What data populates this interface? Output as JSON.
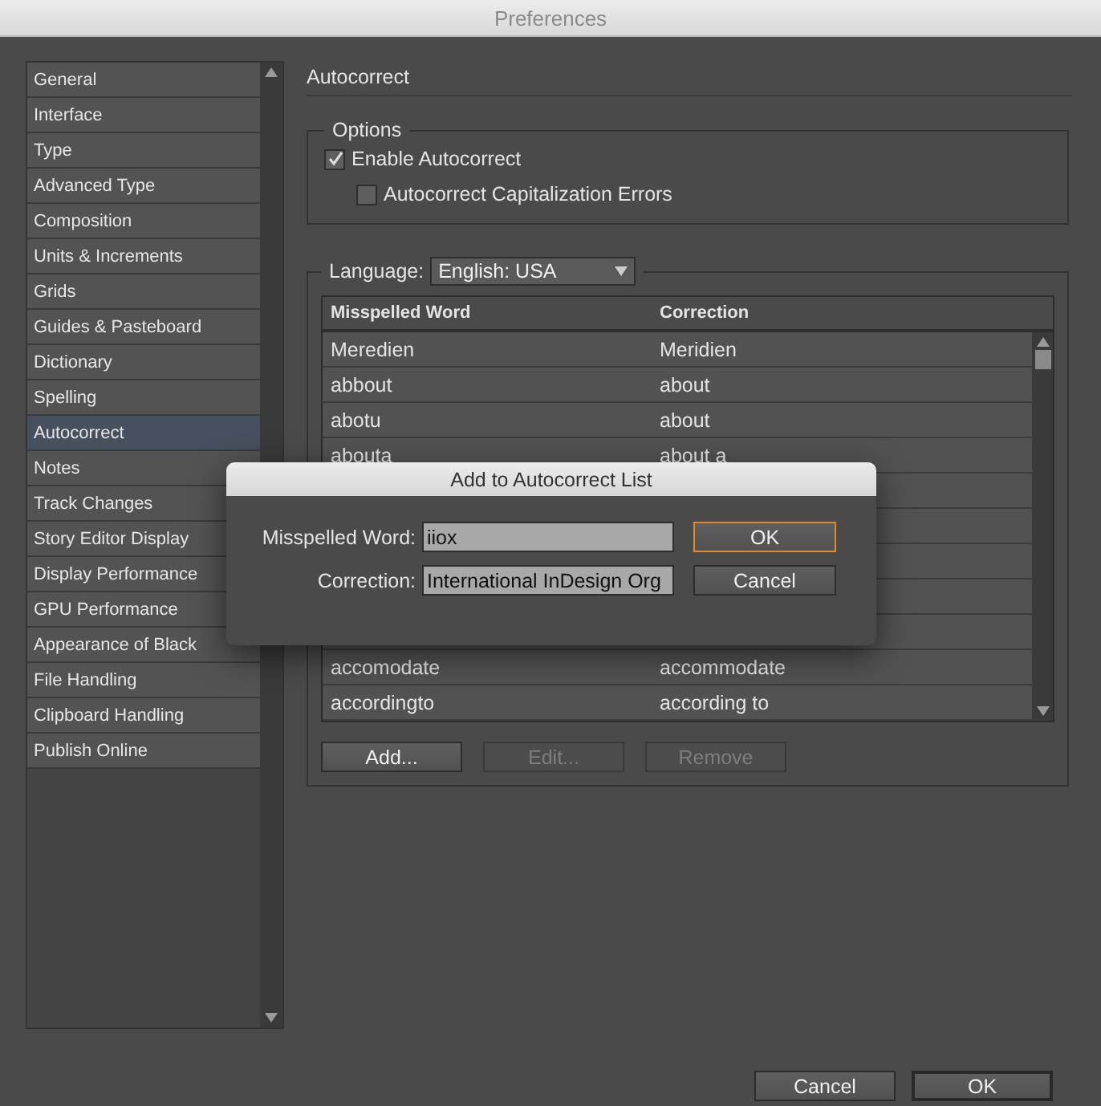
{
  "window": {
    "title": "Preferences"
  },
  "sidebar": {
    "items": [
      {
        "label": "General",
        "selected": false
      },
      {
        "label": "Interface",
        "selected": false
      },
      {
        "label": "Type",
        "selected": false
      },
      {
        "label": "Advanced Type",
        "selected": false
      },
      {
        "label": "Composition",
        "selected": false
      },
      {
        "label": "Units & Increments",
        "selected": false
      },
      {
        "label": "Grids",
        "selected": false
      },
      {
        "label": "Guides & Pasteboard",
        "selected": false
      },
      {
        "label": "Dictionary",
        "selected": false
      },
      {
        "label": "Spelling",
        "selected": false
      },
      {
        "label": "Autocorrect",
        "selected": true
      },
      {
        "label": "Notes",
        "selected": false
      },
      {
        "label": "Track Changes",
        "selected": false
      },
      {
        "label": "Story Editor Display",
        "selected": false
      },
      {
        "label": "Display Performance",
        "selected": false
      },
      {
        "label": "GPU Performance",
        "selected": false
      },
      {
        "label": "Appearance of Black",
        "selected": false
      },
      {
        "label": "File Handling",
        "selected": false
      },
      {
        "label": "Clipboard Handling",
        "selected": false
      },
      {
        "label": "Publish Online",
        "selected": false
      }
    ]
  },
  "panel": {
    "title": "Autocorrect",
    "options": {
      "title": "Options",
      "checkboxes": [
        {
          "label": "Enable Autocorrect",
          "checked": true,
          "children": [
            {
              "label": "Autocorrect Capitalization Errors",
              "checked": false
            }
          ]
        }
      ]
    },
    "language": {
      "label": "Language:",
      "value": "English: USA"
    },
    "table": {
      "columns": [
        "Misspelled Word",
        "Correction"
      ],
      "rows": [
        {
          "cells": [
            "Meredien",
            "Meridien"
          ]
        },
        {
          "cells": [
            "abbout",
            "about"
          ]
        },
        {
          "cells": [
            "abotu",
            "about"
          ]
        },
        {
          "cells": [
            "abouta",
            "about a"
          ]
        },
        {
          "covered": true
        },
        {
          "covered": true
        },
        {
          "covered": true
        },
        {
          "covered": true
        },
        {
          "covered": true
        },
        {
          "cells": [
            "accomodate",
            "accommodate"
          ]
        },
        {
          "cells": [
            "accordingto",
            "according to"
          ]
        }
      ]
    },
    "buttons": [
      {
        "label": "Add...",
        "disabled": false
      },
      {
        "label": "Edit...",
        "disabled": true
      },
      {
        "label": "Remove",
        "disabled": true
      }
    ]
  },
  "dialog": {
    "title": "Add to Autocorrect List",
    "fields": [
      {
        "label": "Misspelled Word:",
        "value": "iiox"
      },
      {
        "label": "Correction:",
        "value": "International InDesign Org"
      }
    ],
    "buttons": [
      {
        "label": "OK",
        "default": true
      },
      {
        "label": "Cancel",
        "default": false
      }
    ]
  },
  "footer_buttons": [
    {
      "label": "Cancel",
      "default": false
    },
    {
      "label": "OK",
      "default": true
    }
  ]
}
